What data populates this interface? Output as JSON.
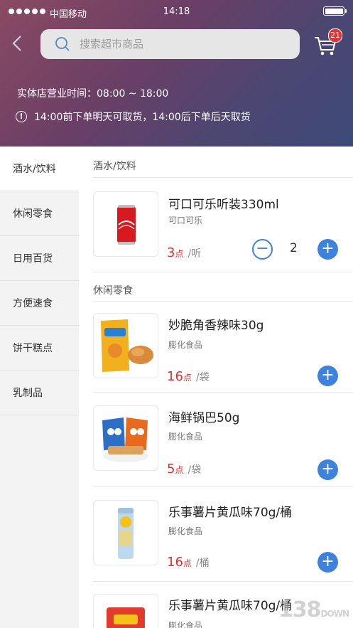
{
  "status_bar": {
    "carrier": "中国移动",
    "time": "14:18"
  },
  "search": {
    "placeholder": "搜索超市商品"
  },
  "cart": {
    "badge": "21"
  },
  "store_hours": "实体店营业时间：08:00 ~ 18:00",
  "pickup_notice": "14:00前下单明天可取货，14:00后下单后天取货",
  "sidebar": {
    "categories": [
      {
        "label": "酒水/饮料",
        "active": true
      },
      {
        "label": "休闲零食"
      },
      {
        "label": "日用百货"
      },
      {
        "label": "方便速食"
      },
      {
        "label": "饼干糕点"
      },
      {
        "label": "乳制品"
      }
    ]
  },
  "sections": [
    {
      "title": "酒水/饮料",
      "products": [
        {
          "name": "可口可乐听装330ml",
          "brand": "可口可乐",
          "price": "3",
          "point_label": "点",
          "unit": "/听",
          "quantity": "2",
          "image": "coke-can"
        }
      ]
    },
    {
      "title": "休闲零食",
      "products": [
        {
          "name": "妙脆角香辣味30g",
          "brand": "膨化食品",
          "price": "16",
          "point_label": "点",
          "unit": "/袋",
          "image": "snack-bag"
        },
        {
          "name": "海鲜锅巴50g",
          "brand": "膨化食品",
          "price": "5",
          "point_label": "点",
          "unit": "/袋",
          "image": "crispy-rice-bags"
        },
        {
          "name": "乐事薯片黄瓜味70g/桶",
          "brand": "膨化食品",
          "price": "16",
          "point_label": "点",
          "unit": "/桶",
          "image": "chips-can"
        },
        {
          "name": "乐事薯片黄瓜味70g/桶",
          "brand": "膨化食品",
          "image": "chips-bag"
        }
      ]
    }
  ],
  "icons": {
    "back": "chevron-left-icon",
    "search": "search-icon",
    "cart": "cart-icon",
    "info": "info-icon",
    "plus": "plus-icon",
    "minus": "minus-icon"
  },
  "colors": {
    "accent": "#3d82dc",
    "price": "#e02e2e",
    "badge": "#e63434"
  },
  "watermark": {
    "text": "138",
    "suffix": "DOWN"
  }
}
